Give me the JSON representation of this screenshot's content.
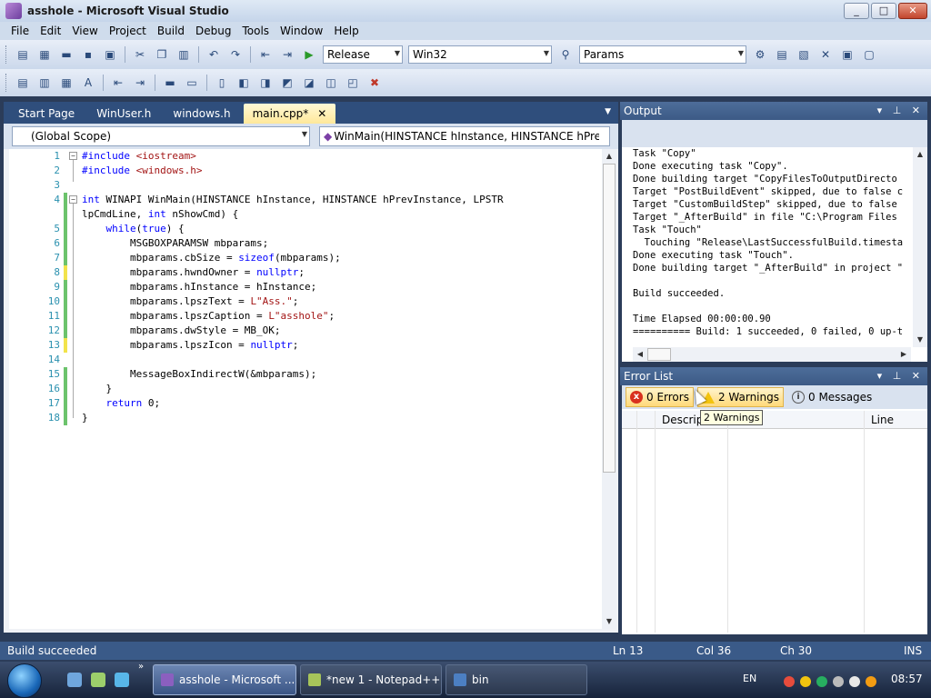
{
  "window": {
    "title": "asshole - Microsoft Visual Studio",
    "minimize": "_",
    "maximize": "□",
    "close": "✕"
  },
  "menu": [
    "File",
    "Edit",
    "View",
    "Project",
    "Build",
    "Debug",
    "Tools",
    "Window",
    "Help"
  ],
  "toolbar": {
    "configuration": "Release",
    "platform": "Win32",
    "find_combo": "Params"
  },
  "tabs": [
    {
      "label": "Start Page"
    },
    {
      "label": "WinUser.h"
    },
    {
      "label": "windows.h"
    },
    {
      "label": "main.cpp*",
      "close": "✕"
    }
  ],
  "scope": {
    "left": "(Global Scope)",
    "right": "WinMain(HINSTANCE hInstance, HINSTANCE hPrevInstance"
  },
  "code_lines": [
    {
      "n": "1",
      "text": "#include <iostream>"
    },
    {
      "n": "2",
      "text": "#include <windows.h>"
    },
    {
      "n": "3",
      "text": ""
    },
    {
      "n": "4",
      "text": "int WINAPI WinMain(HINSTANCE hInstance, HINSTANCE hPrevInstance, LPSTR"
    },
    {
      "n": "",
      "text": "lpCmdLine, int nShowCmd) {"
    },
    {
      "n": "5",
      "text": "    while(true) {"
    },
    {
      "n": "6",
      "text": "        MSGBOXPARAMSW mbparams;"
    },
    {
      "n": "7",
      "text": "        mbparams.cbSize = sizeof(mbparams);"
    },
    {
      "n": "8",
      "text": "        mbparams.hwndOwner = nullptr;"
    },
    {
      "n": "9",
      "text": "        mbparams.hInstance = hInstance;"
    },
    {
      "n": "10",
      "text": "        mbparams.lpszText = L\"Ass.\";"
    },
    {
      "n": "11",
      "text": "        mbparams.lpszCaption = L\"asshole\";"
    },
    {
      "n": "12",
      "text": "        mbparams.dwStyle = MB_OK;"
    },
    {
      "n": "13",
      "text": "        mbparams.lpszIcon = nullptr;"
    },
    {
      "n": "14",
      "text": ""
    },
    {
      "n": "15",
      "text": "        MessageBoxIndirectW(&mbparams);"
    },
    {
      "n": "16",
      "text": "    }"
    },
    {
      "n": "17",
      "text": "    return 0;"
    },
    {
      "n": "18",
      "text": "}"
    }
  ],
  "output": {
    "title": "Output",
    "lines": [
      "Task \"Copy\"",
      "Done executing task \"Copy\".",
      "Done building target \"CopyFilesToOutputDirecto",
      "Target \"PostBuildEvent\" skipped, due to false c",
      "Target \"CustomBuildStep\" skipped, due to false",
      "Target \"_AfterBuild\" in file \"C:\\Program Files",
      "Task \"Touch\"",
      "  Touching \"Release\\LastSuccessfulBuild.timesta",
      "Done executing task \"Touch\".",
      "Done building target \"_AfterBuild\" in project \"",
      "",
      "Build succeeded.",
      "",
      "Time Elapsed 00:00:00.90",
      "========== Build: 1 succeeded, 0 failed, 0 up-t"
    ]
  },
  "error_list": {
    "title": "Error List",
    "errors": "0 Errors",
    "warnings": "2 Warnings",
    "messages": "0 Messages",
    "col_description": "Descripti",
    "col_line": "Line",
    "tooltip": "2 Warnings"
  },
  "status": {
    "text": "Build succeeded",
    "ln": "Ln 13",
    "col": "Col 36",
    "ch": "Ch 30",
    "mode": "INS"
  },
  "taskbar": {
    "items": [
      {
        "label": "asshole - Microsoft ...",
        "active": true
      },
      {
        "label": "*new 1 - Notepad++",
        "active": false
      },
      {
        "label": "bin",
        "active": false
      }
    ],
    "lang": "EN",
    "clock": "08:57"
  }
}
